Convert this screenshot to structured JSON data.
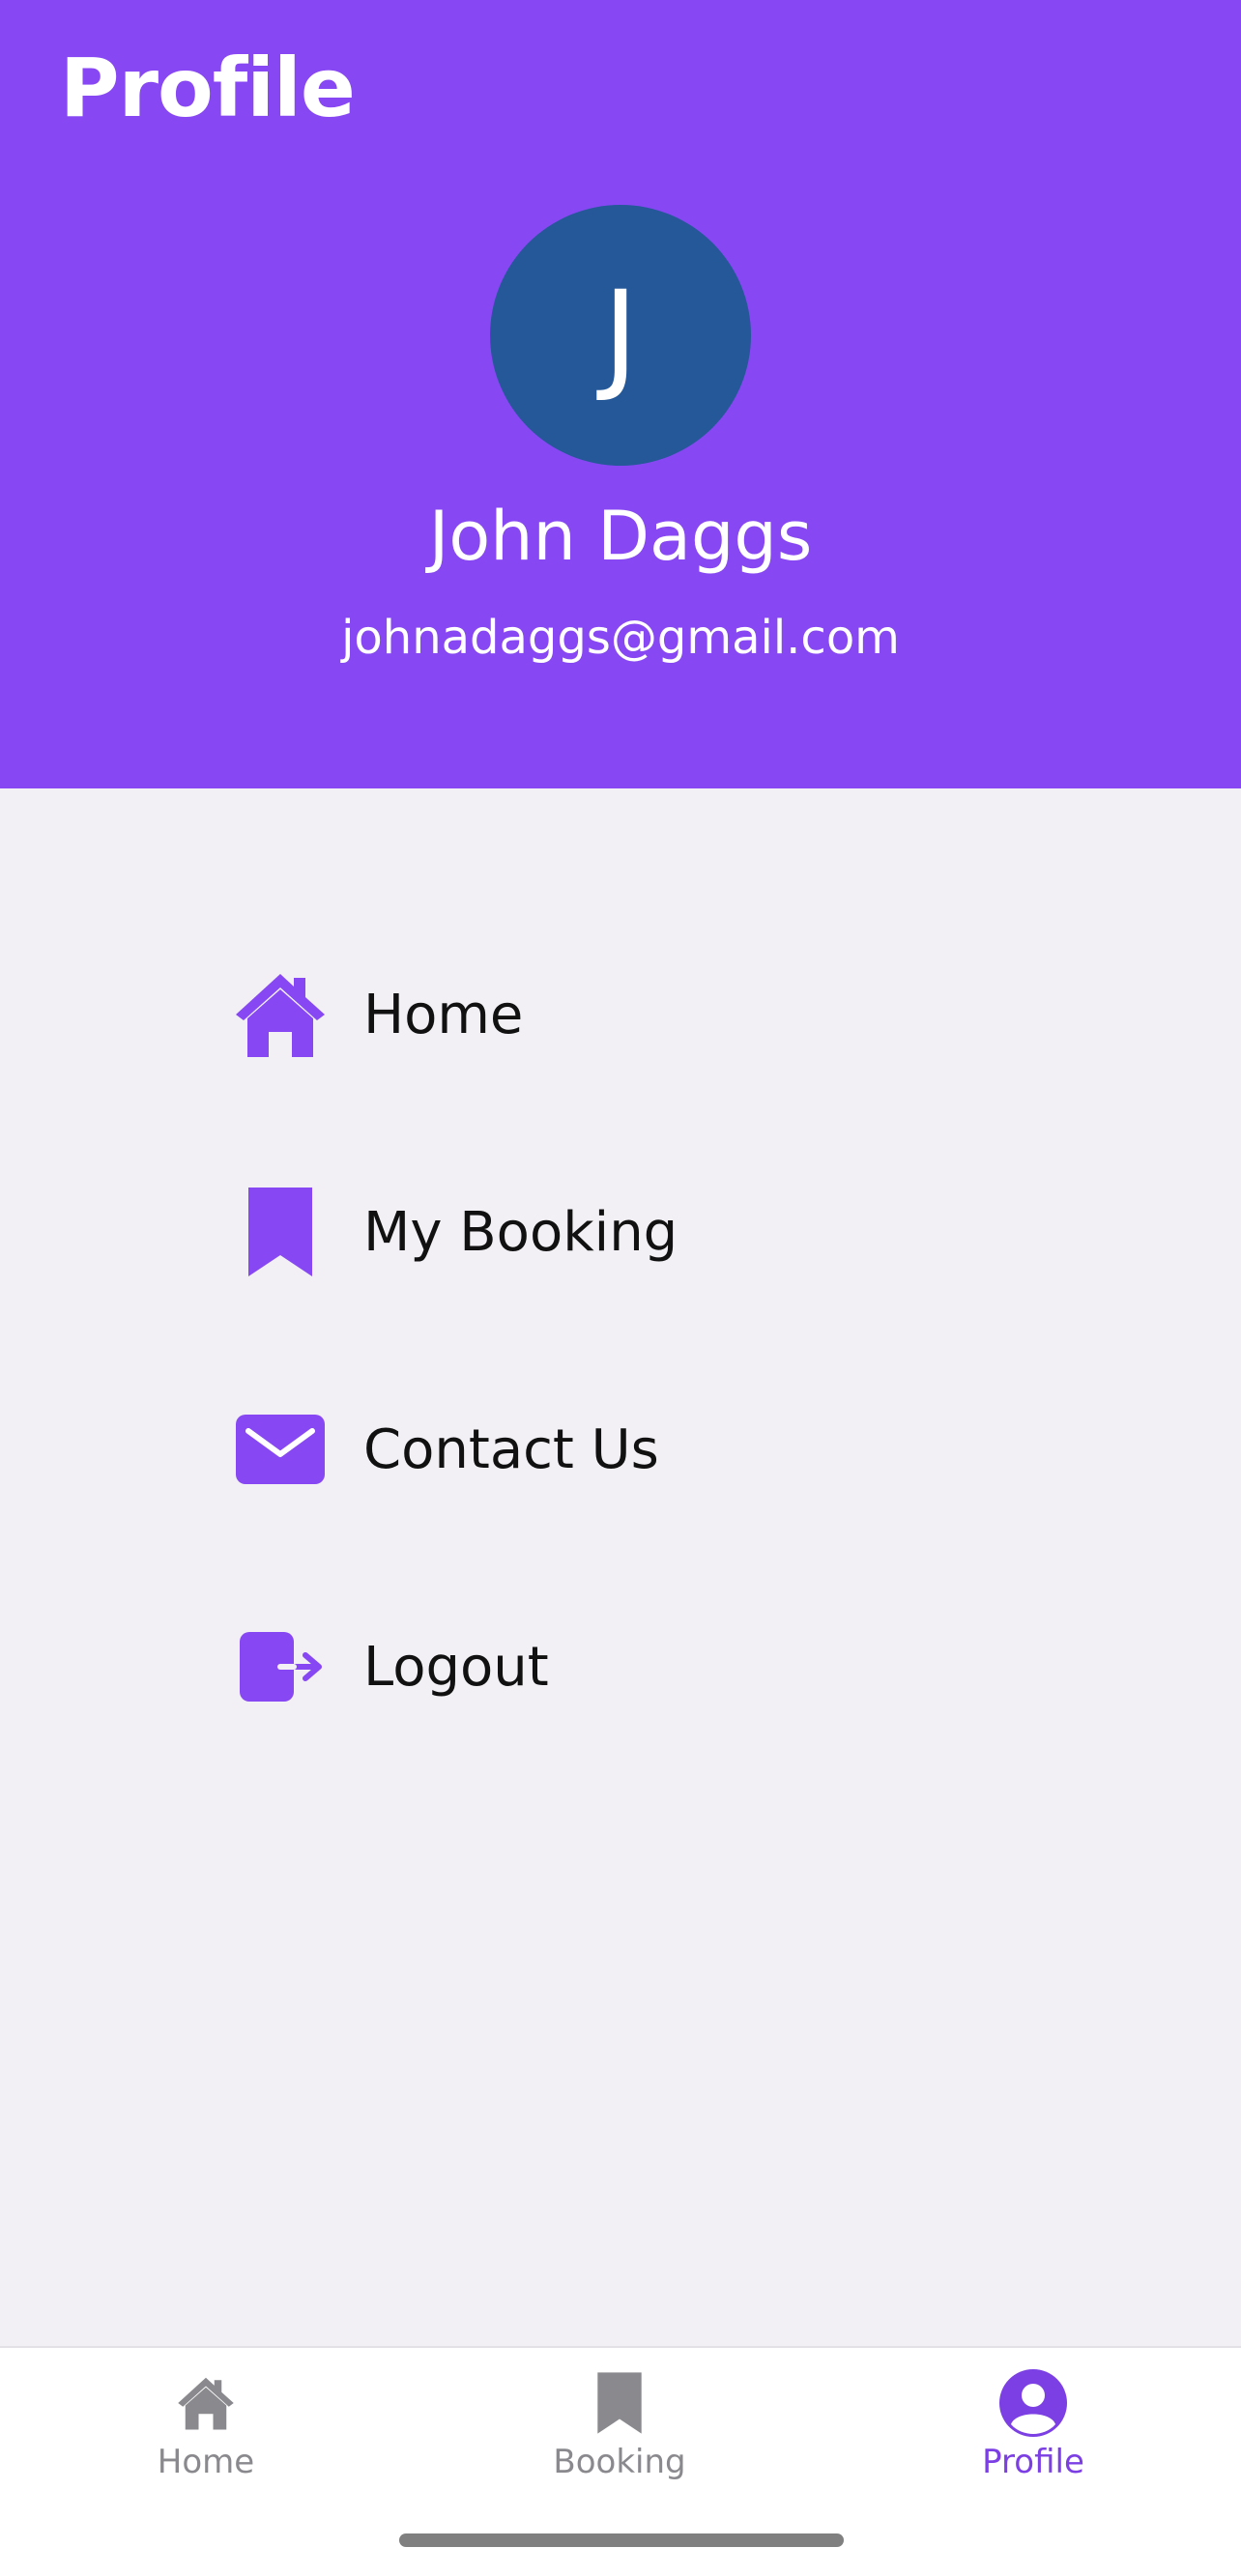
{
  "header": {
    "title": "Profile",
    "avatar_initial": "J",
    "user_name": "John Daggs",
    "user_email": "johnadaggs@gmail.com"
  },
  "menu": {
    "items": [
      {
        "label": "Home",
        "icon": "home-icon"
      },
      {
        "label": "My Booking",
        "icon": "bookmark-icon"
      },
      {
        "label": "Contact Us",
        "icon": "mail-icon"
      },
      {
        "label": "Logout",
        "icon": "logout-icon"
      }
    ]
  },
  "bottom_nav": {
    "items": [
      {
        "label": "Home",
        "icon": "home-icon",
        "active": false
      },
      {
        "label": "Booking",
        "icon": "bookmark-icon",
        "active": false
      },
      {
        "label": "Profile",
        "icon": "user-circle-icon",
        "active": true
      }
    ]
  },
  "colors": {
    "primary": "#8748f3",
    "avatar_bg": "#245899",
    "background": "#f2f0f4",
    "nav_inactive": "#8a8a8e",
    "nav_active": "#7b3fe4"
  }
}
